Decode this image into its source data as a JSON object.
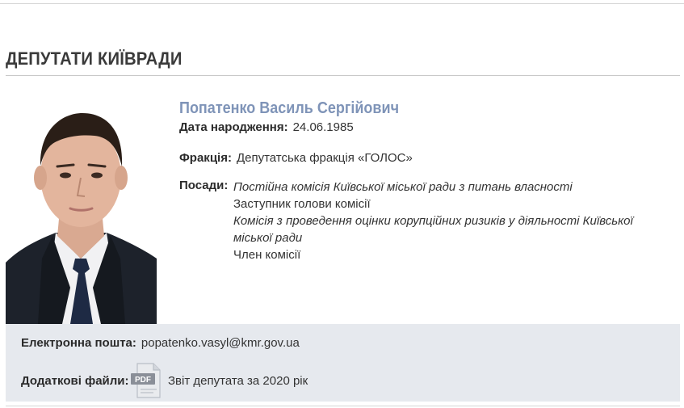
{
  "page": {
    "section_title": "ДЕПУТАТИ КИЇВРАДИ"
  },
  "deputy": {
    "name": "Попатенко Василь Сергійович",
    "birth_label": "Дата народження:",
    "birth_value": "24.06.1985",
    "faction_label": "Фракція:",
    "faction_value": "Депутатська фракція «ГОЛОС»",
    "posts_label": "Посади:",
    "posts": [
      {
        "commission": "Постійна комісія Київської міської ради з питань власності",
        "role": "Заступник голови комісії"
      },
      {
        "commission": "Комісія з проведення оцінки корупційних ризиків у діяльності Київської міської ради",
        "role": "Член комісії"
      }
    ]
  },
  "contacts": {
    "email_label": "Електронна пошта:",
    "email_value": "popatenko.vasyl@kmr.gov.ua",
    "files_label": "Додаткові файли:",
    "file_icon_text": "PDF",
    "file_icon": "pdf-file-icon",
    "file_link": "Звіт депутата за 2020 рік"
  },
  "colors": {
    "name_accent": "#7f94b8",
    "info_background": "#e6e9ee",
    "suit": "#1d222b",
    "tie": "#1e2a44"
  }
}
